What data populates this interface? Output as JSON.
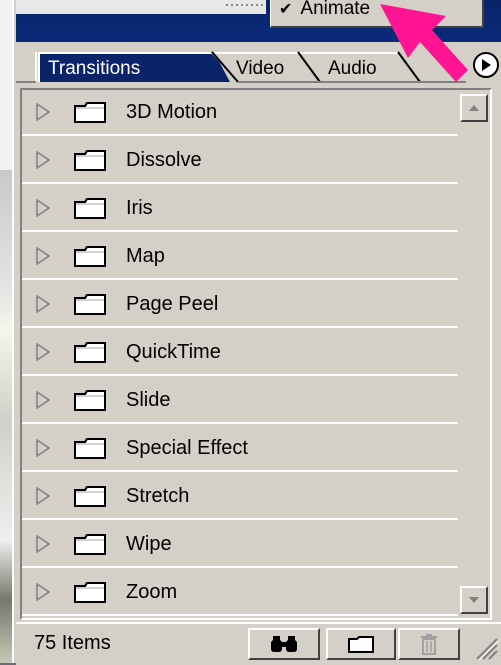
{
  "menu": {
    "checked_item": "Animate"
  },
  "tabs": [
    {
      "label": "Transitions",
      "active": true
    },
    {
      "label": "Video",
      "active": false
    },
    {
      "label": "Audio",
      "active": false
    }
  ],
  "list": {
    "items": [
      {
        "label": "3D Motion"
      },
      {
        "label": "Dissolve"
      },
      {
        "label": "Iris"
      },
      {
        "label": "Map"
      },
      {
        "label": "Page Peel"
      },
      {
        "label": "QuickTime"
      },
      {
        "label": "Slide"
      },
      {
        "label": "Special Effect"
      },
      {
        "label": "Stretch"
      },
      {
        "label": "Wipe"
      },
      {
        "label": "Zoom"
      }
    ]
  },
  "status": {
    "item_count": "75 Items"
  },
  "colors": {
    "title_bar": "#0a246a",
    "panel_bg": "#d4d0c8",
    "annotation_arrow": "#ff1493"
  }
}
